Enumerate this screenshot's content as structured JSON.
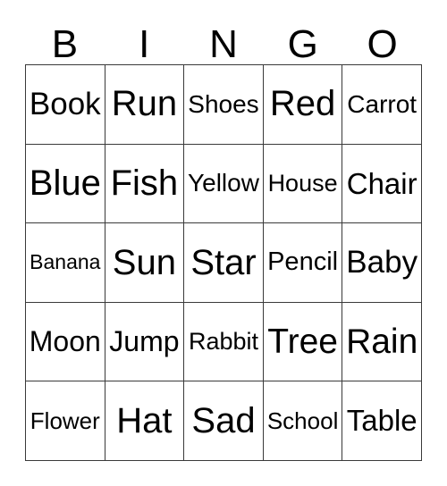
{
  "card": {
    "title": "BINGO",
    "header_letters": [
      "B",
      "I",
      "N",
      "G",
      "O"
    ],
    "columns": 5,
    "rows": 5,
    "colors": {
      "background": "#ffffff",
      "text": "#000000",
      "border": "#3a3a3a"
    },
    "grid": [
      [
        {
          "label": "Book",
          "column": "B",
          "row": 1,
          "marked": false
        },
        {
          "label": "Run",
          "column": "I",
          "row": 1,
          "marked": false
        },
        {
          "label": "Shoes",
          "column": "N",
          "row": 1,
          "marked": false
        },
        {
          "label": "Red",
          "column": "G",
          "row": 1,
          "marked": false
        },
        {
          "label": "Carrot",
          "column": "O",
          "row": 1,
          "marked": false
        }
      ],
      [
        {
          "label": "Blue",
          "column": "B",
          "row": 2,
          "marked": false
        },
        {
          "label": "Fish",
          "column": "I",
          "row": 2,
          "marked": false
        },
        {
          "label": "Yellow",
          "column": "N",
          "row": 2,
          "marked": false
        },
        {
          "label": "House",
          "column": "G",
          "row": 2,
          "marked": false
        },
        {
          "label": "Chair",
          "column": "O",
          "row": 2,
          "marked": false
        }
      ],
      [
        {
          "label": "Banana",
          "column": "B",
          "row": 3,
          "marked": false
        },
        {
          "label": "Sun",
          "column": "I",
          "row": 3,
          "marked": false
        },
        {
          "label": "Star",
          "column": "N",
          "row": 3,
          "marked": false
        },
        {
          "label": "Pencil",
          "column": "G",
          "row": 3,
          "marked": false
        },
        {
          "label": "Baby",
          "column": "O",
          "row": 3,
          "marked": false
        }
      ],
      [
        {
          "label": "Moon",
          "column": "B",
          "row": 4,
          "marked": false
        },
        {
          "label": "Jump",
          "column": "I",
          "row": 4,
          "marked": false
        },
        {
          "label": "Rabbit",
          "column": "N",
          "row": 4,
          "marked": false
        },
        {
          "label": "Tree",
          "column": "G",
          "row": 4,
          "marked": false
        },
        {
          "label": "Rain",
          "column": "O",
          "row": 4,
          "marked": false
        }
      ],
      [
        {
          "label": "Flower",
          "column": "B",
          "row": 5,
          "marked": false
        },
        {
          "label": "Hat",
          "column": "I",
          "row": 5,
          "marked": false
        },
        {
          "label": "Sad",
          "column": "N",
          "row": 5,
          "marked": false
        },
        {
          "label": "School",
          "column": "G",
          "row": 5,
          "marked": false
        },
        {
          "label": "Table",
          "column": "O",
          "row": 5,
          "marked": false
        }
      ]
    ]
  }
}
